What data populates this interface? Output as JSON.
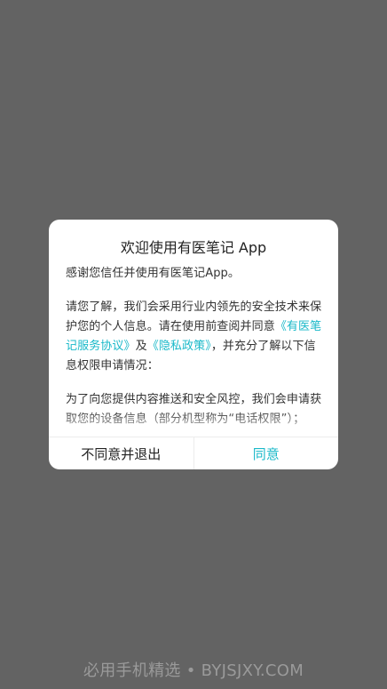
{
  "dialog": {
    "title": "欢迎使用有医笔记 App",
    "paragraph1": "感谢您信任并使用有医笔记App。",
    "paragraph2": {
      "text_before": "请您了解，我们会采用行业内领先的安全技术来保护您的个人信息。请在使用前查阅并同意",
      "link_service": "《有医笔记服务协议》",
      "text_and": "及",
      "link_privacy": "《隐私政策》",
      "text_after": "，并充分了解以下信息权限申请情况："
    },
    "paragraph3": "为了向您提供内容推送和安全风控，我们会申请获取您的设备信息（部分机型称为“电话权限”）；",
    "decline_label": "不同意并退出",
    "agree_label": "同意"
  },
  "watermark": "必用手机精选 • BYJSJXY.COM",
  "colors": {
    "overlay": "#636363",
    "accent": "#1ab9c9"
  }
}
